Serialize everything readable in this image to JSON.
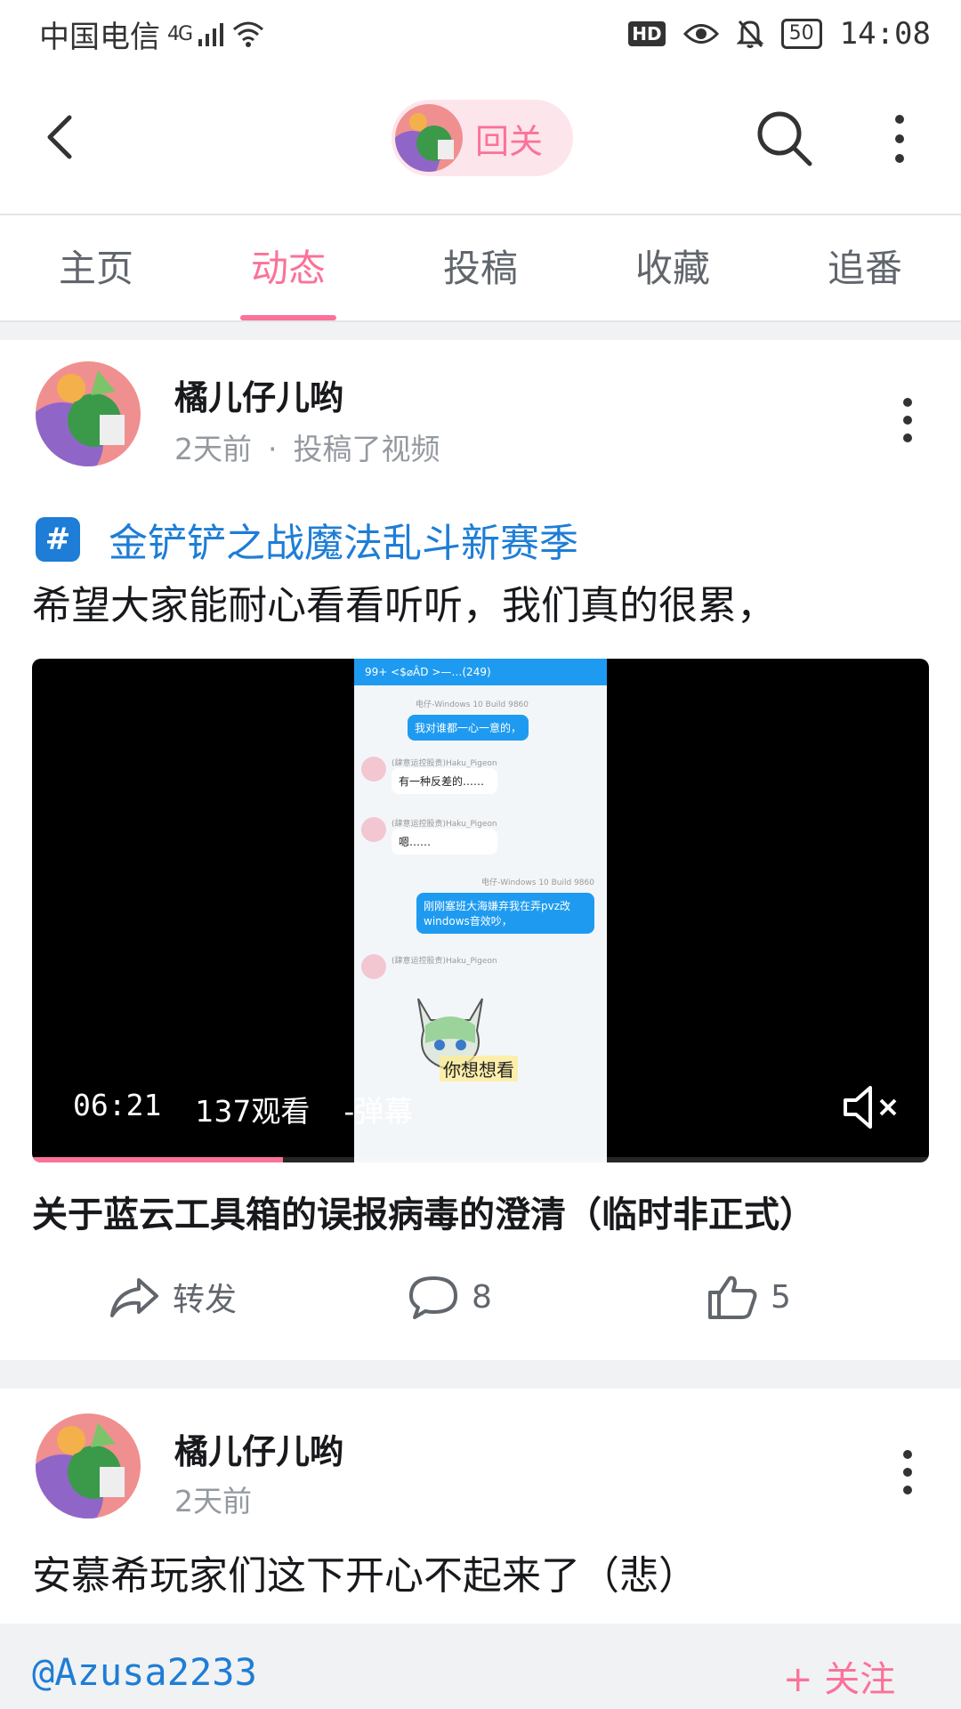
{
  "status_bar": {
    "carrier": "中国电信",
    "network": "4G",
    "hd": "HD",
    "battery": "50",
    "time": "14:08"
  },
  "header": {
    "follow_label": "回关"
  },
  "tabs": [
    {
      "label": "主页",
      "active": false
    },
    {
      "label": "动态",
      "active": true
    },
    {
      "label": "投稿",
      "active": false
    },
    {
      "label": "收藏",
      "active": false
    },
    {
      "label": "追番",
      "active": false
    }
  ],
  "posts": [
    {
      "author": "橘儿仔儿哟",
      "time": "2天前",
      "dot": "·",
      "action": "投稿了视频",
      "topic": "金铲铲之战魔法乱斗新赛季",
      "text": "希望大家能耐心看看听听，我们真的很累，",
      "video": {
        "duration": "06:21",
        "views": "137观看",
        "danmaku": "-弹幕",
        "title": "关于蓝云工具箱的误报病毒的澄清（临时非正式）",
        "screen": {
          "header": "99+  <$⌀ÂD >—…(249)",
          "messages": [
            {
              "name": "电仔-Windows 10 Build 9860",
              "text": "我对谁都一心一意的，",
              "me": true
            },
            {
              "name": "(肆意运控股责)Haku_Pigeon",
              "text": "有一种反差的……",
              "me": false
            },
            {
              "name": "(肆意运控股责)Haku_Pigeon",
              "text": "嗯……",
              "me": false
            },
            {
              "name": "电仔-Windows 10 Build 9860",
              "text": "刚刚塞班大海嫌弃我在弄pvz改windows音效吵，",
              "me": true
            },
            {
              "name": "(肆意运控股责)Haku_Pigeon",
              "text": "",
              "me": false
            }
          ],
          "subtitle": "你想想看"
        },
        "progress": 0.28
      },
      "stats": {
        "share_label": "转发",
        "comments": "8",
        "likes": "5"
      }
    },
    {
      "author": "橘儿仔儿哟",
      "time": "2天前",
      "text": "安慕希玩家们这下开心不起来了（悲）",
      "mention": "@Azusa2233",
      "follow_label": "+ 关注"
    }
  ],
  "colors": {
    "accent": "#fb7299",
    "link": "#1e7dd6",
    "text": "#18191c",
    "muted": "#9499a0"
  }
}
